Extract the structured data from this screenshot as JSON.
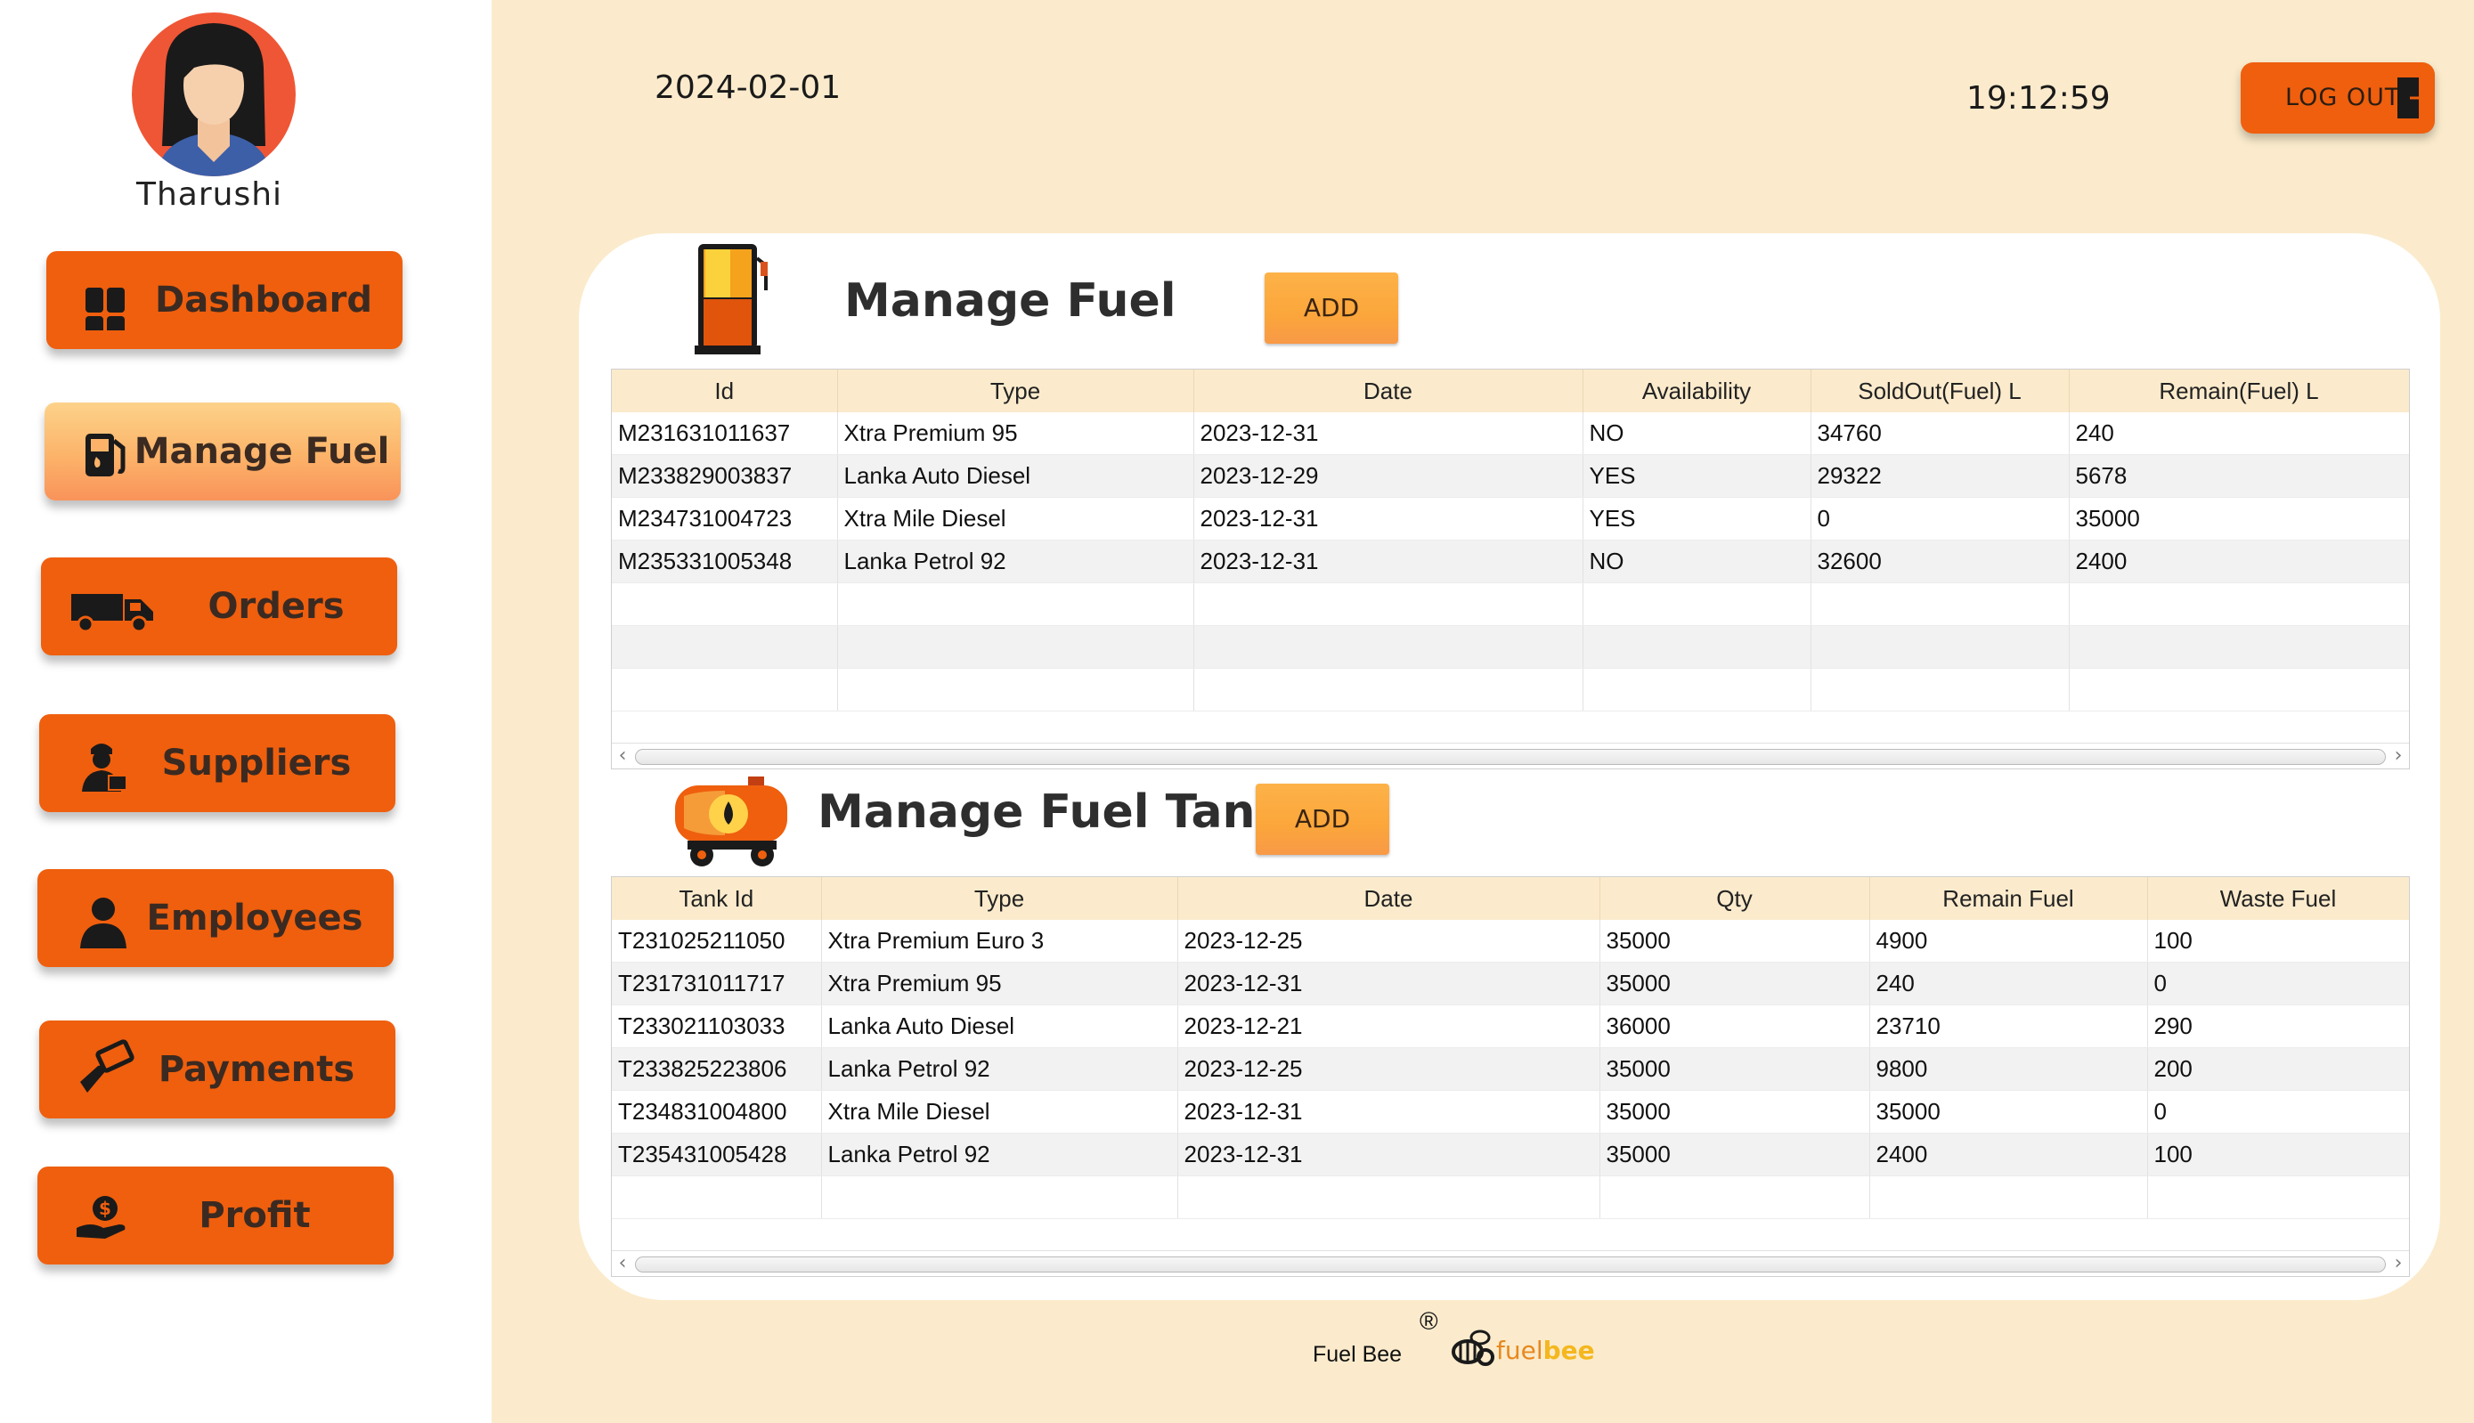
{
  "user": {
    "name": "Tharushi"
  },
  "sidebar": {
    "items": [
      {
        "label": "Dashboard",
        "icon": "dashboard-grid-icon"
      },
      {
        "label": "Manage Fuel",
        "icon": "fuel-pump-icon",
        "active": true
      },
      {
        "label": "Orders",
        "icon": "delivery-truck-icon"
      },
      {
        "label": "Suppliers",
        "icon": "supplier-person-icon"
      },
      {
        "label": "Employees",
        "icon": "employee-person-icon"
      },
      {
        "label": "Payments",
        "icon": "payment-hand-icon"
      },
      {
        "label": "Profit",
        "icon": "profit-hand-icon"
      }
    ]
  },
  "header": {
    "date": "2024-02-01",
    "time": "19:12:59",
    "logout_label": "LOG OUT"
  },
  "manage_fuel": {
    "title": "Manage Fuel",
    "add_label": "ADD",
    "columns": [
      "Id",
      "Type",
      "Date",
      "Availability",
      "SoldOut(Fuel) L",
      "Remain(Fuel) L"
    ],
    "rows": [
      [
        "M231631011637",
        "Xtra Premium 95",
        "2023-12-31",
        "NO",
        "34760",
        "240"
      ],
      [
        "M233829003837",
        "Lanka Auto Diesel",
        "2023-12-29",
        "YES",
        "29322",
        "5678"
      ],
      [
        "M234731004723",
        "Xtra Mile Diesel",
        "2023-12-31",
        "YES",
        "0",
        "35000"
      ],
      [
        "M235331005348",
        "Lanka Petrol 92",
        "2023-12-31",
        "NO",
        "32600",
        "2400"
      ],
      [
        "",
        "",
        "",
        "",
        "",
        ""
      ],
      [
        "",
        "",
        "",
        "",
        "",
        ""
      ],
      [
        "",
        "",
        "",
        "",
        "",
        ""
      ]
    ]
  },
  "manage_tanks": {
    "title": "Manage Fuel Tanks",
    "add_label": "ADD",
    "columns": [
      "Tank Id",
      "Type",
      "Date",
      "Qty",
      "Remain Fuel",
      "Waste Fuel"
    ],
    "rows": [
      [
        "T231025211050",
        "Xtra Premium Euro 3",
        "2023-12-25",
        "35000",
        "4900",
        "100"
      ],
      [
        "T231731011717",
        "Xtra Premium 95",
        "2023-12-31",
        "35000",
        "240",
        "0"
      ],
      [
        "T233021103033",
        "Lanka Auto Diesel",
        "2023-12-21",
        "36000",
        "23710",
        "290"
      ],
      [
        "T233825223806",
        "Lanka Petrol 92",
        "2023-12-25",
        "35000",
        "9800",
        "200"
      ],
      [
        "T234831004800",
        "Xtra Mile Diesel",
        "2023-12-31",
        "35000",
        "35000",
        "0"
      ],
      [
        "T235431005428",
        "Lanka Petrol 92",
        "2023-12-31",
        "35000",
        "2400",
        "100"
      ],
      [
        "",
        "",
        "",
        "",
        "",
        ""
      ]
    ]
  },
  "footer": {
    "text": "Fuel Bee",
    "registered": "®",
    "brand_fuel": "fuel",
    "brand_bee": "bee"
  },
  "colors": {
    "accent": "#ef5f0e",
    "background": "#fbebcc",
    "add_button": "#fba63b"
  }
}
